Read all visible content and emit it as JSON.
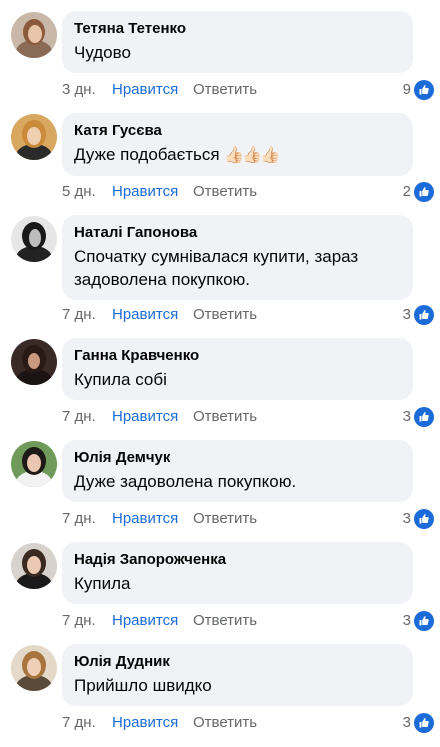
{
  "ui": {
    "like_label": "Нравится",
    "reply_label": "Ответить",
    "like_icon": "thumbs-up-icon",
    "like_color": "#1b6cd8",
    "bubble_color": "#f0f2f5"
  },
  "comments": [
    {
      "author": "Тетяна Тетенко",
      "text": "Чудово",
      "emoji": "",
      "time": "3 дн.",
      "likes": "9"
    },
    {
      "author": "Катя Гусєва",
      "text": "Дуже подобається",
      "emoji": "👍🏻👍🏻👍🏻",
      "time": "5 дн.",
      "likes": "2"
    },
    {
      "author": "Наталі Гапонова",
      "text": "Спочатку сумнівалася купити, зараз задоволена покупкою.",
      "emoji": "",
      "time": "7 дн.",
      "likes": "3"
    },
    {
      "author": "Ганна Кравченко",
      "text": "Купила собі",
      "emoji": "",
      "time": "7 дн.",
      "likes": "3"
    },
    {
      "author": "Юлія Демчук",
      "text": "Дуже задоволена покупкою.",
      "emoji": "",
      "time": "7 дн.",
      "likes": "3"
    },
    {
      "author": "Надія Запорожченка",
      "text": "Купила",
      "emoji": "",
      "time": "7 дн.",
      "likes": "3"
    },
    {
      "author": "Юлія Дудник",
      "text": "Прийшло швидко",
      "emoji": "",
      "time": "7 дн.",
      "likes": "3"
    }
  ]
}
